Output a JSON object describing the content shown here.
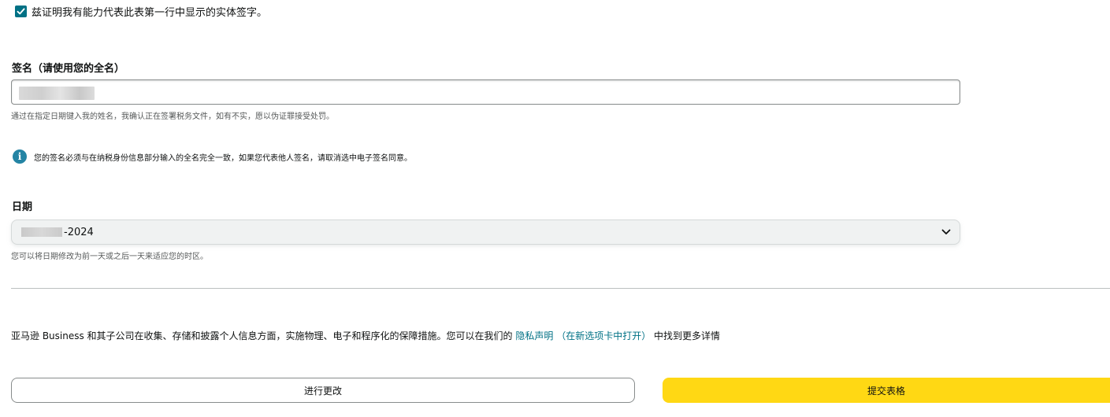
{
  "certification": {
    "checked": true,
    "text": "兹证明我有能力代表此表第一行中显示的实体签字。"
  },
  "signature": {
    "label": "签名（请使用您的全名）",
    "value": "",
    "helper": "通过在指定日期键入我的姓名，我确认正在签署税务文件，如有不实，愿以伪证罪接受处罚。"
  },
  "info_notice": {
    "icon": "info-icon",
    "text": "您的签名必须与在纳税身份信息部分输入的全名完全一致，如果您代表他人签名，请取消选中电子签名同意。"
  },
  "date": {
    "label": "日期",
    "value": "-2024",
    "helper": "您可以将日期修改为前一天或之后一天来适应您的时区。",
    "icon": "chevron-down-icon"
  },
  "privacy": {
    "text_before": "亚马逊 Business 和其子公司在收集、存储和披露个人信息方面，实施物理、电子和程序化的保障措施。您可以在我们的 ",
    "link_text": "隐私声明 （在新选项卡中打开）",
    "text_after": " 中找到更多详情"
  },
  "buttons": {
    "make_changes": "进行更改",
    "submit": "提交表格"
  },
  "colors": {
    "checkbox": "#007185",
    "info_icon": "#2484a4",
    "link": "#007185",
    "submit_button": "#ffd814"
  }
}
